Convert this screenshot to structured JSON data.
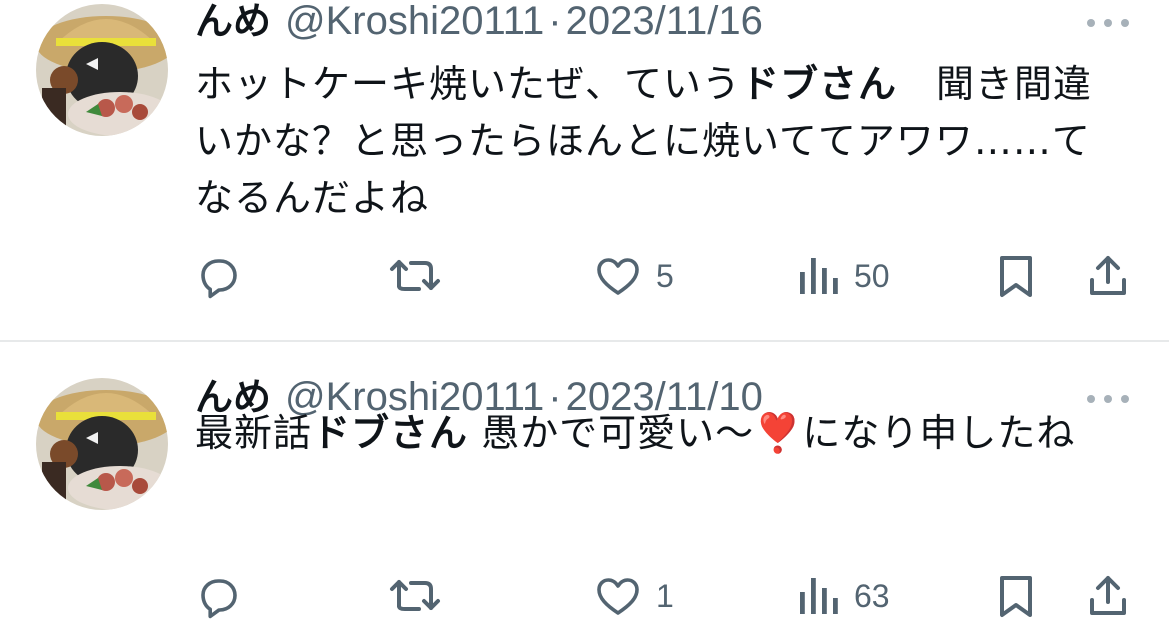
{
  "tweets": [
    {
      "display_name": "んめ",
      "handle": "@Kroshi20111",
      "separator": "·",
      "date": "2023/11/16",
      "text_segments": [
        {
          "text": "ホットケーキ焼いたぜ、ていう",
          "bold": false
        },
        {
          "text": "ドブさん",
          "bold": true
        },
        {
          "text": "　聞き間違いかな？と思ったらほんとに焼いててアワワ……てなるんだよね",
          "bold": false
        }
      ],
      "replies": "",
      "retweets": "",
      "likes": "5",
      "views": "50"
    },
    {
      "display_name": "んめ",
      "handle": "@Kroshi20111",
      "separator": "·",
      "date": "2023/11/10",
      "text_segments": [
        {
          "text": "最新話",
          "bold": false
        },
        {
          "text": "ドブさん",
          "bold": true
        },
        {
          "text": "  愚かで可愛い〜❣️になり申したね",
          "bold": false
        }
      ],
      "replies": "",
      "retweets": "",
      "likes": "1",
      "views": "63"
    }
  ],
  "icons": {
    "reply": "reply-icon",
    "retweet": "retweet-icon",
    "like": "heart-icon",
    "views": "views-icon",
    "bookmark": "bookmark-icon",
    "share": "share-icon",
    "more": "more-icon"
  },
  "colors": {
    "text": "#0f1419",
    "secondary": "#536471",
    "divider": "#e7e9ea",
    "more_dots": "#a7b1b9"
  }
}
